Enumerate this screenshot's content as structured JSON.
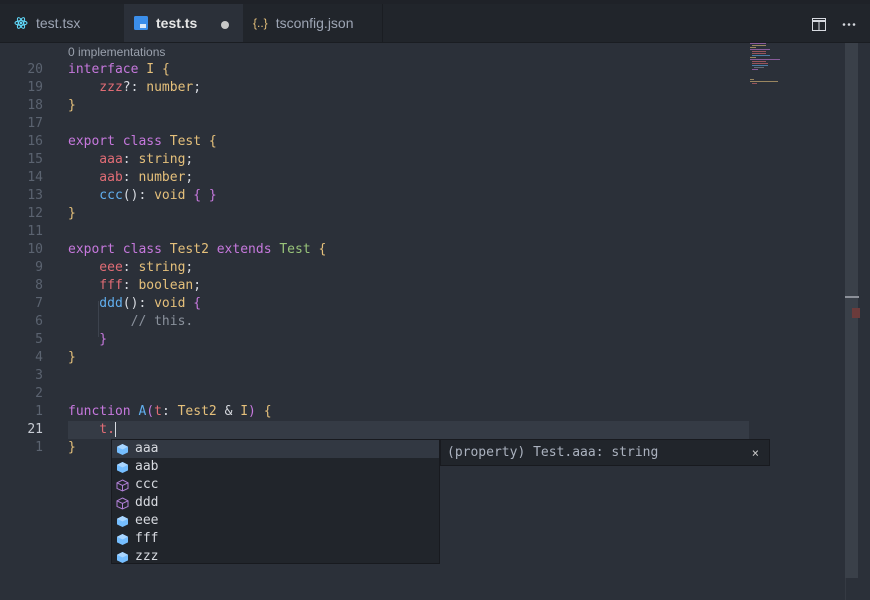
{
  "tabs": [
    {
      "label": "test.tsx",
      "icon": "react-icon",
      "active": false
    },
    {
      "label": "test.ts",
      "icon": "typescript-icon",
      "active": true,
      "modified": true
    },
    {
      "label": "tsconfig.json",
      "icon": "json-icon",
      "active": false
    }
  ],
  "tab_actions": [
    {
      "icon": "split-editor-icon"
    },
    {
      "icon": "more-icon"
    }
  ],
  "codelens": "0 implementations",
  "lines": [
    {
      "num": "20",
      "parts": [
        [
          "interface ",
          "k"
        ],
        [
          "I ",
          "t"
        ],
        [
          "{",
          "b"
        ]
      ]
    },
    {
      "num": "19",
      "parts": [
        [
          "    zzz",
          "p"
        ],
        [
          "?: ",
          "w"
        ],
        [
          "number",
          "t"
        ],
        [
          ";",
          "w"
        ]
      ]
    },
    {
      "num": "18",
      "parts": [
        [
          "}",
          "b"
        ]
      ]
    },
    {
      "num": "17",
      "parts": []
    },
    {
      "num": "16",
      "parts": [
        [
          "export ",
          "k"
        ],
        [
          "class ",
          "k"
        ],
        [
          "Test ",
          "t"
        ],
        [
          "{",
          "b"
        ]
      ]
    },
    {
      "num": "15",
      "parts": [
        [
          "    aaa",
          "p"
        ],
        [
          ": ",
          "w"
        ],
        [
          "string",
          "t"
        ],
        [
          ";",
          "w"
        ]
      ]
    },
    {
      "num": "14",
      "parts": [
        [
          "    aab",
          "p"
        ],
        [
          ": ",
          "w"
        ],
        [
          "number",
          "t"
        ],
        [
          ";",
          "w"
        ]
      ]
    },
    {
      "num": "13",
      "parts": [
        [
          "    ccc",
          "f"
        ],
        [
          "(): ",
          "w"
        ],
        [
          "void ",
          "t"
        ],
        [
          "{ }",
          "bm"
        ]
      ]
    },
    {
      "num": "12",
      "parts": [
        [
          "}",
          "b"
        ]
      ]
    },
    {
      "num": "11",
      "parts": []
    },
    {
      "num": "10",
      "parts": [
        [
          "export ",
          "k"
        ],
        [
          "class ",
          "k"
        ],
        [
          "Test2 ",
          "t"
        ],
        [
          "extends ",
          "k"
        ],
        [
          "Test ",
          "g"
        ],
        [
          "{",
          "b"
        ]
      ]
    },
    {
      "num": "9",
      "parts": [
        [
          "    eee",
          "p"
        ],
        [
          ": ",
          "w"
        ],
        [
          "string",
          "t"
        ],
        [
          ";",
          "w"
        ]
      ]
    },
    {
      "num": "8",
      "parts": [
        [
          "    fff",
          "p"
        ],
        [
          ": ",
          "w"
        ],
        [
          "boolean",
          "t"
        ],
        [
          ";",
          "w"
        ]
      ]
    },
    {
      "num": "7",
      "parts": [
        [
          "    ddd",
          "f"
        ],
        [
          "(): ",
          "w"
        ],
        [
          "void ",
          "t"
        ],
        [
          "{",
          "bm"
        ]
      ]
    },
    {
      "num": "6",
      "parts": [
        [
          "        // this.",
          "c"
        ]
      ]
    },
    {
      "num": "5",
      "parts": [
        [
          "    }",
          "bm"
        ]
      ]
    },
    {
      "num": "4",
      "parts": [
        [
          "}",
          "b"
        ]
      ]
    },
    {
      "num": "3",
      "parts": []
    },
    {
      "num": "2",
      "parts": []
    },
    {
      "num": "1",
      "parts": [
        [
          "function ",
          "k"
        ],
        [
          "A",
          "f"
        ],
        [
          "(",
          "bm"
        ],
        [
          "t",
          "p"
        ],
        [
          ": ",
          "w"
        ],
        [
          "Test2 ",
          "t"
        ],
        [
          "& ",
          "w"
        ],
        [
          "I",
          "t"
        ],
        [
          ") ",
          "bm"
        ],
        [
          "{",
          "b"
        ]
      ]
    },
    {
      "num": "21",
      "parts": [
        [
          "    t.",
          "p"
        ]
      ],
      "current": true
    },
    {
      "num": "1",
      "parts": [
        [
          "}",
          "b"
        ]
      ]
    }
  ],
  "suggestions": [
    {
      "label": "aaa",
      "icon": "property-icon",
      "selected": true
    },
    {
      "label": "aab",
      "icon": "property-icon"
    },
    {
      "label": "ccc",
      "icon": "method-icon"
    },
    {
      "label": "ddd",
      "icon": "method-icon"
    },
    {
      "label": "eee",
      "icon": "property-icon"
    },
    {
      "label": "fff",
      "icon": "property-icon"
    },
    {
      "label": "zzz",
      "icon": "property-icon"
    }
  ],
  "details": {
    "text": "(property) Test.aaa: string",
    "close": "×"
  },
  "colors": {
    "keyword": "#c678dd",
    "type": "#e5c07b",
    "property": "#e06c75",
    "function": "#61afef",
    "class_ref": "#98c379",
    "comment": "#8a919c"
  }
}
